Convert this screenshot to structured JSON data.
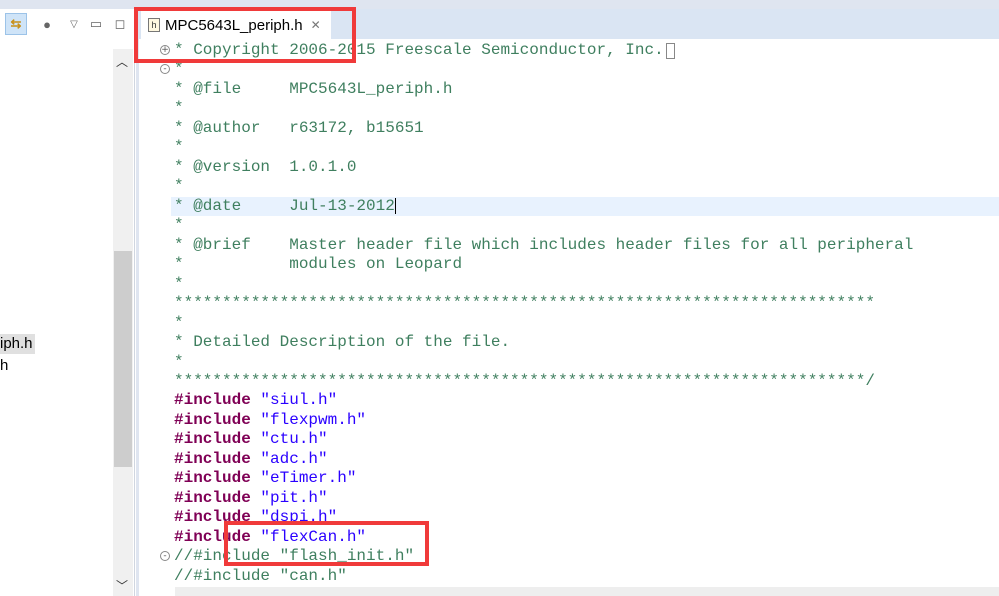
{
  "left_panel": {
    "tree_items": [
      "iph.h",
      "h"
    ]
  },
  "editor": {
    "tab_label": "MPC5643L_periph.h",
    "lines": [
      {
        "t": "c",
        "text": "* Copyright 2006-2015 Freescale Semiconductor, Inc.",
        "fold": "+",
        "box": true
      },
      {
        "t": "c",
        "text": "*",
        "fold": "-"
      },
      {
        "t": "c",
        "text": "* @file     MPC5643L_periph.h"
      },
      {
        "t": "c",
        "text": "*"
      },
      {
        "t": "c",
        "text": "* @author   r63172, b15651"
      },
      {
        "t": "c",
        "text": "*"
      },
      {
        "t": "c",
        "text": "* @version  1.0.1.0"
      },
      {
        "t": "c",
        "text": "*"
      },
      {
        "t": "c",
        "text": "* @date     Jul-13-2012",
        "current": true
      },
      {
        "t": "c",
        "text": "*"
      },
      {
        "t": "c",
        "text": "* @brief    Master header file which includes header files for all peripheral"
      },
      {
        "t": "c",
        "text": "*           modules on Leopard"
      },
      {
        "t": "c",
        "text": "*"
      },
      {
        "t": "c",
        "text": "*************************************************************************"
      },
      {
        "t": "c",
        "text": "*"
      },
      {
        "t": "c",
        "text": "* Detailed Description of the file."
      },
      {
        "t": "c",
        "text": "*"
      },
      {
        "t": "c",
        "text": "************************************************************************/"
      },
      {
        "t": "i",
        "kw": "#include",
        "str": " \"siul.h\""
      },
      {
        "t": "i",
        "kw": "#include",
        "str": " \"flexpwm.h\""
      },
      {
        "t": "i",
        "kw": "#include",
        "str": " \"ctu.h\""
      },
      {
        "t": "i",
        "kw": "#include",
        "str": " \"adc.h\""
      },
      {
        "t": "i",
        "kw": "#include",
        "str": " \"eTimer.h\""
      },
      {
        "t": "i",
        "kw": "#include",
        "str": " \"pit.h\""
      },
      {
        "t": "i",
        "kw": "#include",
        "str": " \"dspi.h\""
      },
      {
        "t": "i",
        "kw": "#include",
        "str": " \"flexCan.h\""
      },
      {
        "t": "c",
        "text": "//#include \"flash_init.h\"",
        "fold": "-"
      },
      {
        "t": "c",
        "text": "//#include \"can.h\""
      }
    ]
  },
  "colors": {
    "comment": "#3f7f5f",
    "keyword": "#7f0055",
    "string": "#2a00ff",
    "annotation": "#f03a3a"
  }
}
